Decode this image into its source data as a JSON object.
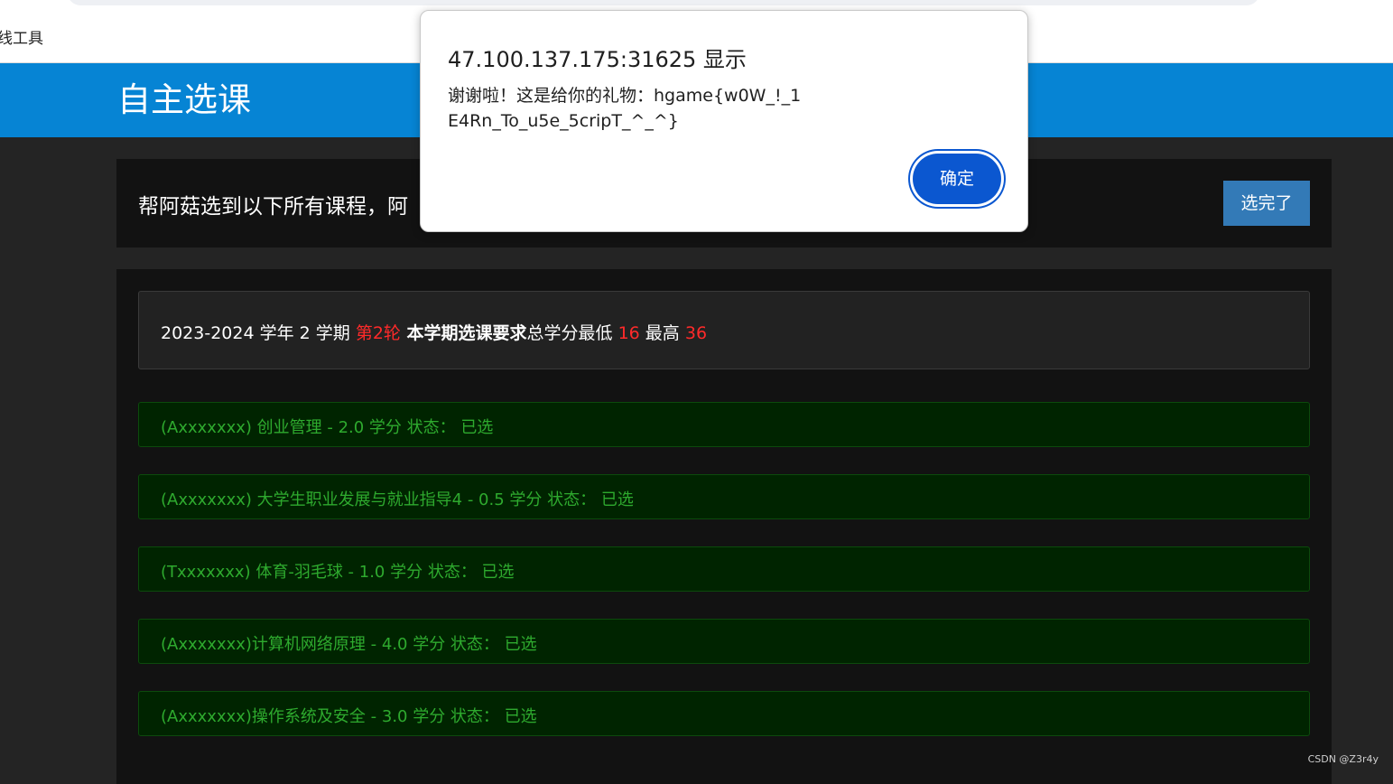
{
  "browser": {
    "bookmark_label": "线工具"
  },
  "header": {
    "title": "自主选课"
  },
  "topbar": {
    "text": "帮阿菇选到以下所有课程，阿",
    "done_button": "选完了"
  },
  "term": {
    "year": "2023-2024 学年 2 学期 ",
    "round": "第2轮",
    "requirement_label": " 本学期选课要求",
    "credits_text": "总学分最低 ",
    "min_credits": "16",
    "max_label": " 最高 ",
    "max_credits": "36"
  },
  "courses": [
    {
      "text": "(Axxxxxxx) 创业管理 - 2.0 学分 状态：  已选"
    },
    {
      "text": "(Axxxxxxx) 大学生职业发展与就业指导4 - 0.5 学分 状态：  已选"
    },
    {
      "text": "(Txxxxxxx) 体育-羽毛球 - 1.0 学分 状态：  已选"
    },
    {
      "text": "(Axxxxxxx)计算机网络原理 - 4.0 学分 状态：  已选"
    },
    {
      "text": "(Axxxxxxx)操作系统及安全 - 3.0 学分 状态：  已选"
    }
  ],
  "dialog": {
    "title": "47.100.137.175:31625 显示",
    "message": "谢谢啦！这是给你的礼物：hgame{w0W_!_1E4Rn_To_u5e_5cripT_^_^}",
    "ok_button": "确定"
  },
  "watermark": "CSDN @Z3r4y",
  "colors": {
    "header_bg": "#0684d4",
    "course_bg": "#002400",
    "course_text": "#2eaa2e",
    "accent_red": "#ff2a2a",
    "done_button_bg": "#337ab7",
    "dialog_button_bg": "#0b57d0"
  }
}
